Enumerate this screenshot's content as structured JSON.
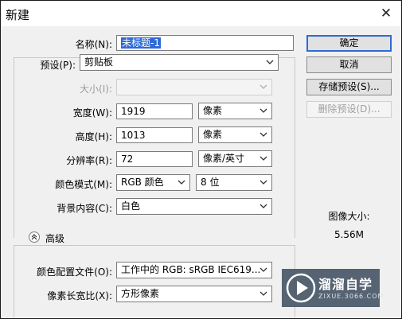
{
  "window": {
    "title": "新建",
    "close_glyph": "✕"
  },
  "name": {
    "label": "名称(N):",
    "value": "未标题-1"
  },
  "preset": {
    "label": "预设(P):",
    "value": "剪贴板"
  },
  "size": {
    "label": "大小(I):",
    "value": ""
  },
  "width": {
    "label": "宽度(W):",
    "value": "1919",
    "unit": "像素"
  },
  "height": {
    "label": "高度(H):",
    "value": "1013",
    "unit": "像素"
  },
  "resolution": {
    "label": "分辨率(R):",
    "value": "72",
    "unit": "像素/英寸"
  },
  "color_mode": {
    "label": "颜色模式(M):",
    "value": "RGB 颜色",
    "depth": "8 位"
  },
  "background": {
    "label": "背景内容(C):",
    "value": "白色"
  },
  "advanced": {
    "label": "高级"
  },
  "color_profile": {
    "label": "颜色配置文件(O):",
    "value": "工作中的 RGB: sRGB IEC619..."
  },
  "pixel_aspect": {
    "label": "像素长宽比(X):",
    "value": "方形像素"
  },
  "buttons": {
    "ok": "确定",
    "cancel": "取消",
    "save_preset": "存储预设(S)...",
    "delete_preset": "删除预设(D)..."
  },
  "image_size": {
    "label": "图像大小:",
    "value": "5.56M"
  },
  "watermark": {
    "brand": "溜溜自学",
    "url": "ZIXUE.3066.COM"
  },
  "colors": {
    "accent": "#2e6ad6",
    "dialog_bg": "#f0f0f0",
    "logo_bg": "#3a4a5c"
  }
}
